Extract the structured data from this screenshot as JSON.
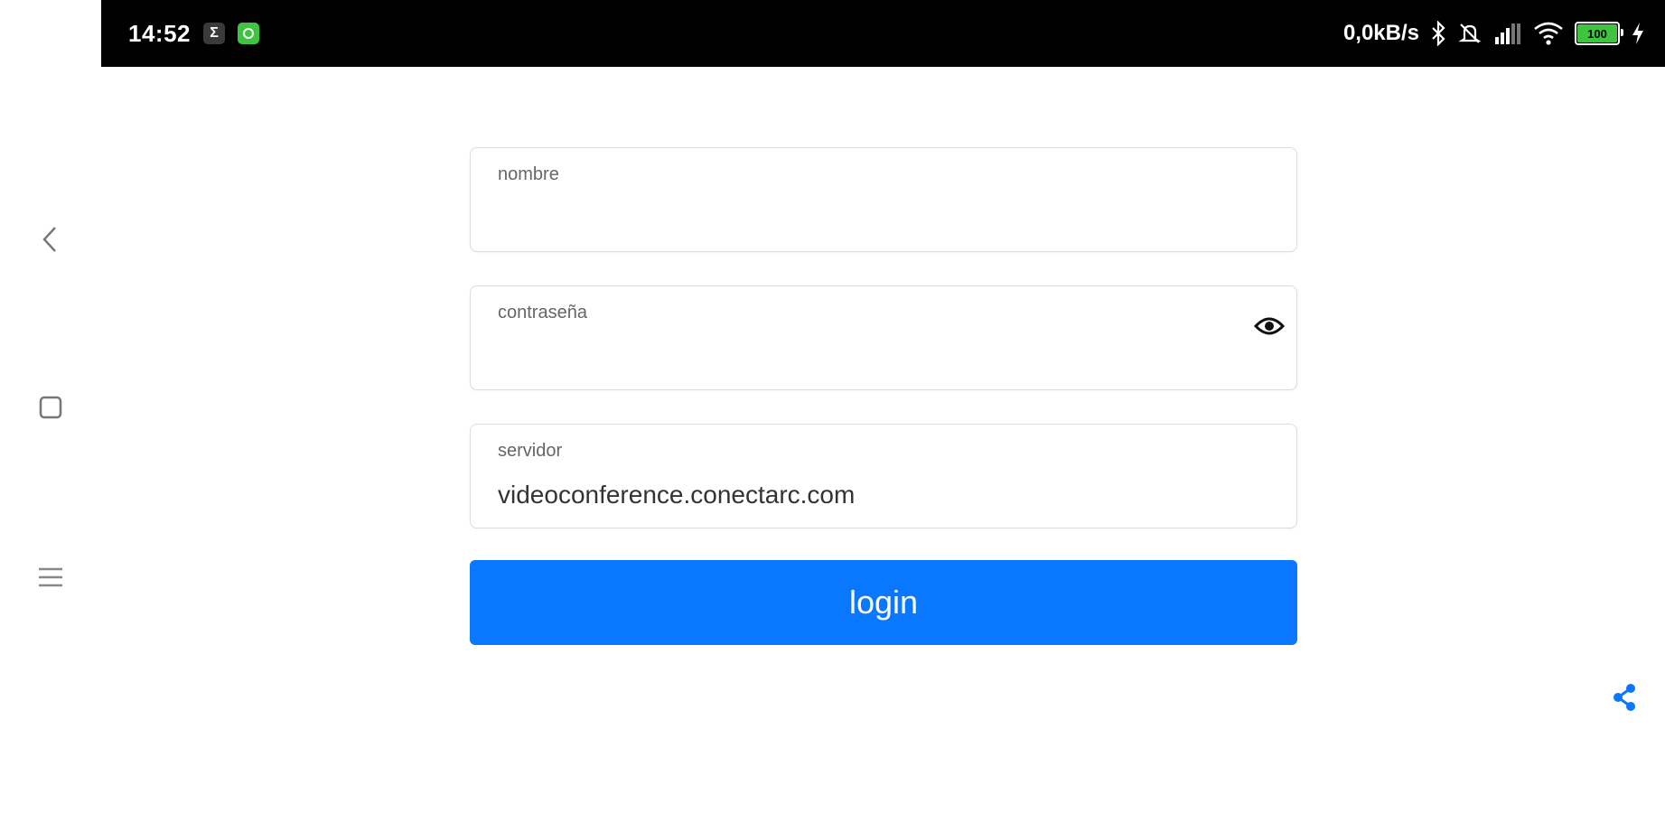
{
  "status_bar": {
    "time": "14:52",
    "sigma_icon": "Σ",
    "network_speed": "0,0kB/s",
    "battery_level": "100",
    "icons": [
      "sigma-icon",
      "app-notification-icon",
      "bluetooth-icon",
      "mute-icon",
      "signal-icon",
      "wifi-icon",
      "battery-icon",
      "charging-icon"
    ]
  },
  "form": {
    "name_label": "nombre",
    "name_value": "",
    "password_label": "contraseña",
    "password_value": "",
    "server_label": "servidor",
    "server_value": "videoconference.conectarc.com",
    "login_label": "login"
  },
  "colors": {
    "primary": "#0a77ff",
    "status_bar": "#000000",
    "battery": "#3ec43e"
  }
}
